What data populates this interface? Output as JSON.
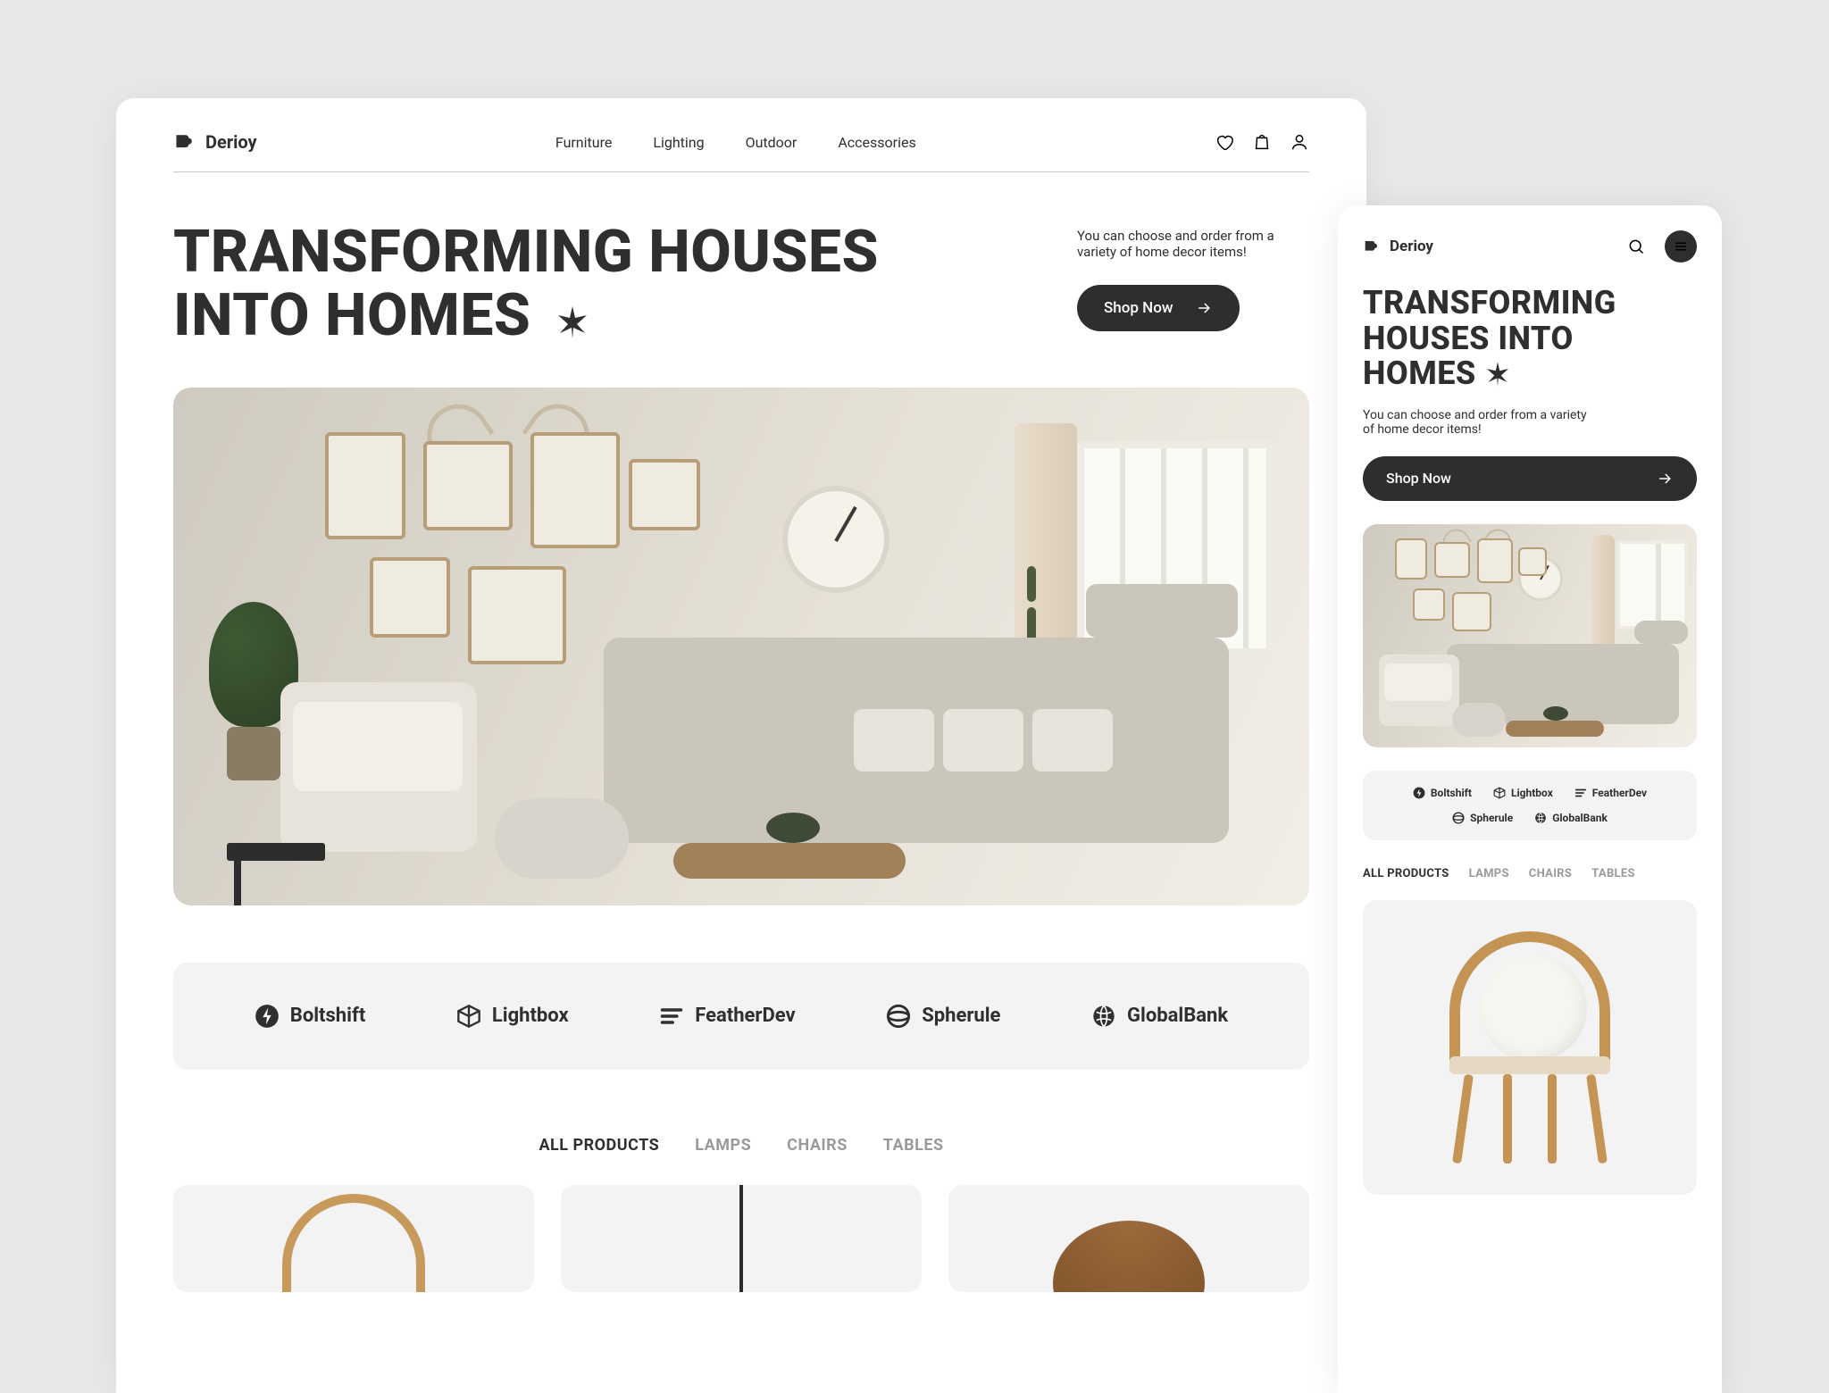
{
  "brand": {
    "name": "Derioy"
  },
  "nav": [
    "Furniture",
    "Lighting",
    "Outdoor",
    "Accessories"
  ],
  "hero": {
    "line1": "TRANSFORMING HOUSES",
    "line2": "INTO HOMES",
    "sub": "You can choose and order from a variety of home decor items!",
    "cta": "Shop Now"
  },
  "brands": [
    "Boltshift",
    "Lightbox",
    "FeatherDev",
    "Spherule",
    "GlobalBank"
  ],
  "tabs": [
    "ALL PRODUCTS",
    "LAMPS",
    "CHAIRS",
    "TABLES"
  ],
  "mobile": {
    "hero_line1": "TRANSFORMING",
    "hero_line2": "HOUSES INTO",
    "hero_line3": "HOMES"
  }
}
